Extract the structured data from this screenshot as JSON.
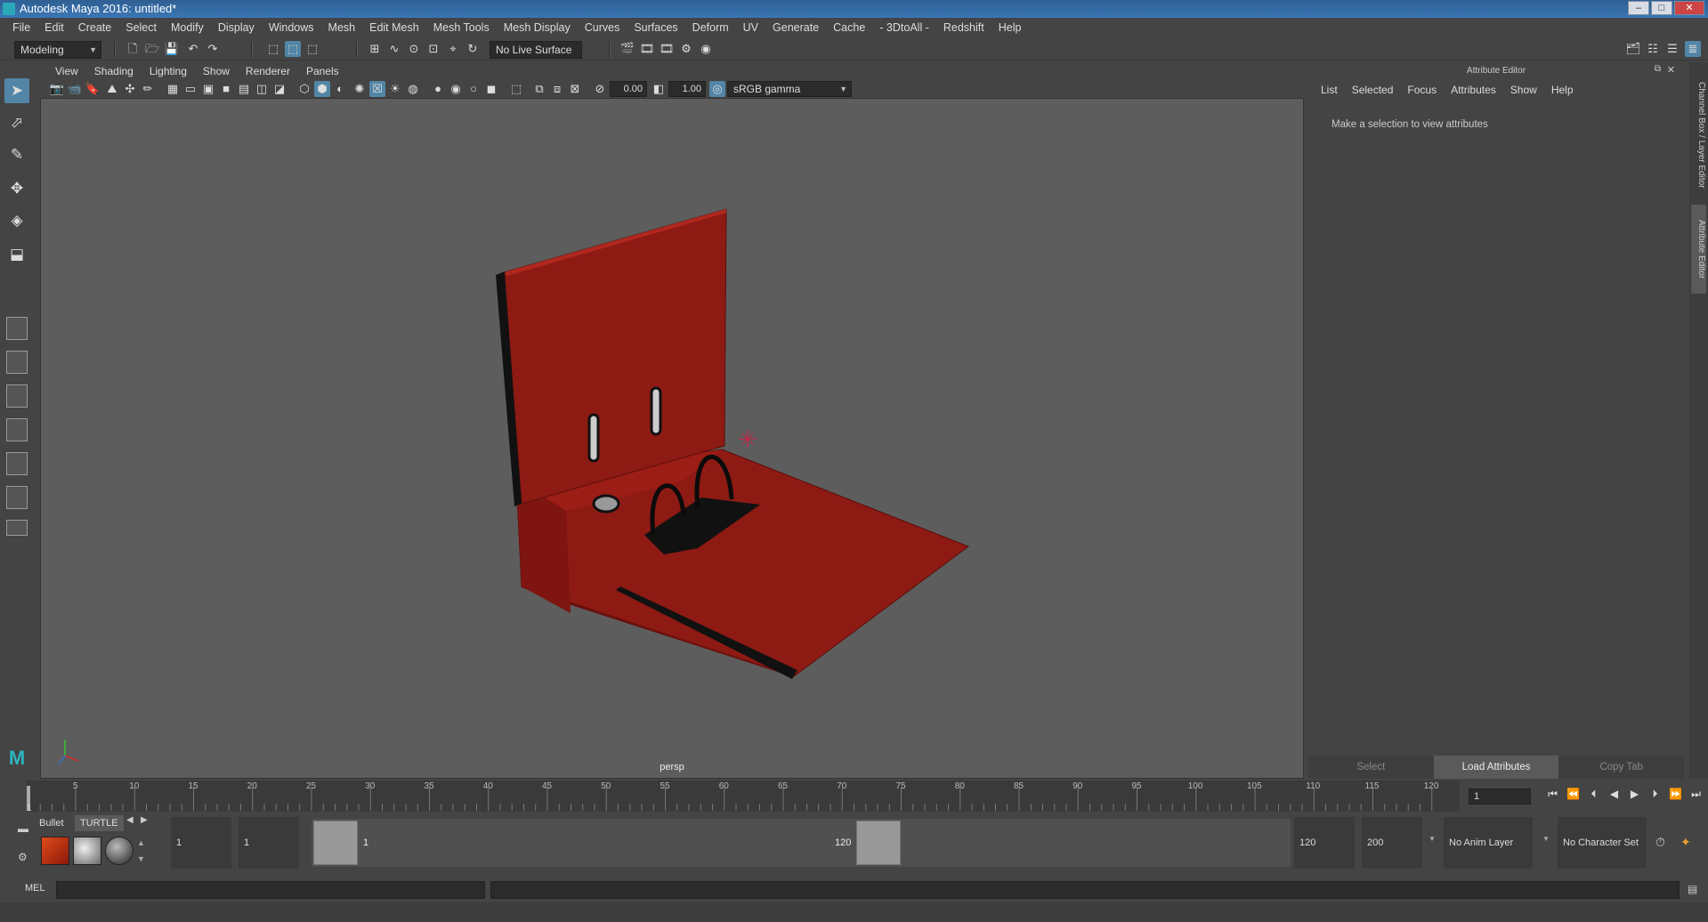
{
  "window": {
    "title": "Autodesk Maya 2016: untitled*"
  },
  "menubar": [
    "File",
    "Edit",
    "Create",
    "Select",
    "Modify",
    "Display",
    "Windows",
    "Mesh",
    "Edit Mesh",
    "Mesh Tools",
    "Mesh Display",
    "Curves",
    "Surfaces",
    "Deform",
    "UV",
    "Generate",
    "Cache",
    "- 3DtoAll -",
    "Redshift",
    "Help"
  ],
  "status_line": {
    "menu_set": "Modeling",
    "live_surface": "No Live Surface"
  },
  "panel": {
    "menus": [
      "View",
      "Shading",
      "Lighting",
      "Show",
      "Renderer",
      "Panels"
    ],
    "exposure": "0.00",
    "gamma": "1.00",
    "color_space": "sRGB gamma",
    "camera_label": "persp"
  },
  "attribute_editor": {
    "title": "Attribute Editor",
    "menus": [
      "List",
      "Selected",
      "Focus",
      "Attributes",
      "Show",
      "Help"
    ],
    "message": "Make a selection to view attributes",
    "buttons": [
      "Select",
      "Load Attributes",
      "Copy Tab"
    ]
  },
  "side_tabs": {
    "channel_box": "Channel Box / Layer Editor",
    "attribute_editor": "Attribute Editor"
  },
  "time_slider": {
    "start_label": "1",
    "tick_labels": [
      "5",
      "10",
      "15",
      "20",
      "25",
      "30",
      "35",
      "40",
      "45",
      "50",
      "55",
      "60",
      "65",
      "70",
      "75",
      "80",
      "85",
      "90",
      "95",
      "100",
      "105",
      "110",
      "115",
      "120"
    ],
    "current_frame": "1"
  },
  "shelf": {
    "tabs": [
      "Bullet",
      "TURTLE"
    ]
  },
  "range_slider": {
    "start_frame": "1",
    "playback_start": "1",
    "range_start_label": "1",
    "range_end_label": "120",
    "playback_end": "120",
    "end_frame": "200",
    "anim_layer": "No Anim Layer",
    "character_set": "No Character Set"
  },
  "command_line": {
    "language": "MEL"
  },
  "colors": {
    "binder_red": "#8e1a14",
    "binder_red_light": "#a32018",
    "viewport_bg": "#5d5d5d",
    "accent": "#5285a6"
  }
}
